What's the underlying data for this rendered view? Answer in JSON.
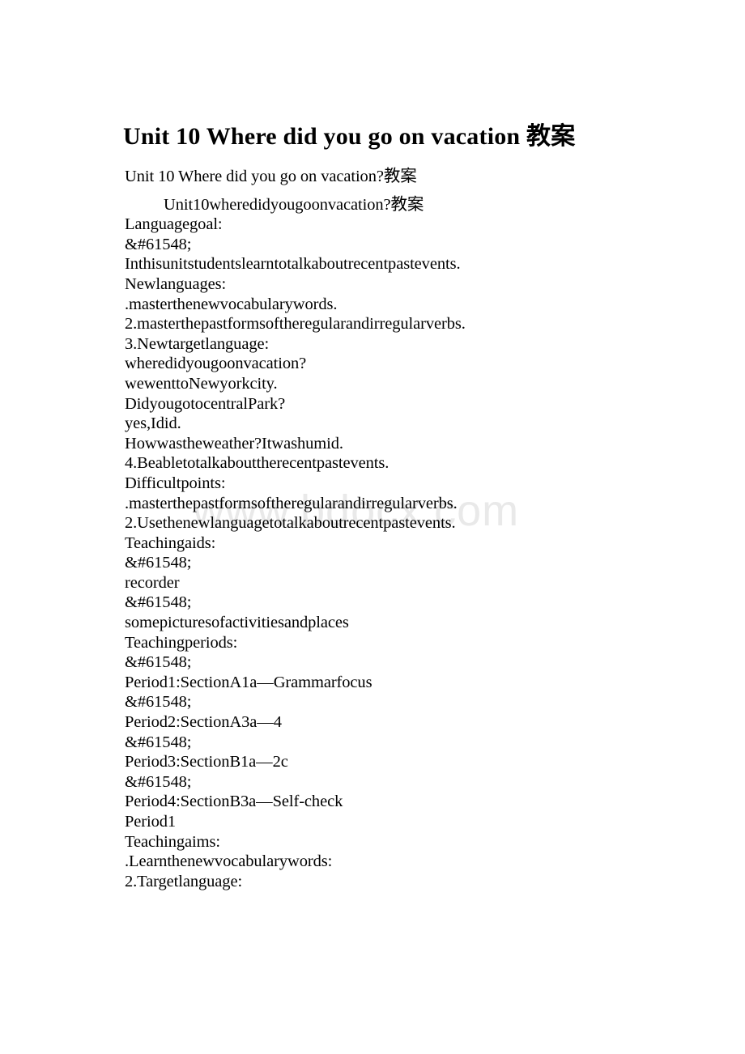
{
  "document": {
    "title": "Unit 10 Where did you go on vacation 教案",
    "watermark": "www.bdocx.com",
    "lines": [
      {
        "text": "Unit 10 Where did you go on vacation?教案",
        "indent": false,
        "gap_before": false
      },
      {
        "text": "Unit10wheredidyougoonvacation?教案",
        "indent": true,
        "gap_before": true
      },
      {
        "text": "Languagegoal:",
        "indent": false,
        "gap_before": false
      },
      {
        "text": "&#61548;",
        "indent": false,
        "gap_before": false
      },
      {
        "text": "Inthisunitstudentslearntotalkaboutrecentpastevents.",
        "indent": false,
        "gap_before": false
      },
      {
        "text": "Newlanguages:",
        "indent": false,
        "gap_before": false
      },
      {
        "text": ".masterthenewvocabularywords.",
        "indent": false,
        "gap_before": false
      },
      {
        "text": "2.masterthepastformsoftheregularandirregularverbs.",
        "indent": false,
        "gap_before": false
      },
      {
        "text": "3.Newtargetlanguage:",
        "indent": false,
        "gap_before": false
      },
      {
        "text": "wheredidyougoonvacation?",
        "indent": false,
        "gap_before": false
      },
      {
        "text": "wewenttoNewyorkcity.",
        "indent": false,
        "gap_before": false
      },
      {
        "text": "DidyougotocentralPark?",
        "indent": false,
        "gap_before": false
      },
      {
        "text": "yes,Idid.",
        "indent": false,
        "gap_before": false
      },
      {
        "text": "Howwastheweather?Itwashumid.",
        "indent": false,
        "gap_before": false
      },
      {
        "text": "4.Beabletotalkabouttherecentpastevents.",
        "indent": false,
        "gap_before": false
      },
      {
        "text": "Difficultpoints:",
        "indent": false,
        "gap_before": false
      },
      {
        "text": ".masterthepastformsoftheregularandirregularverbs.",
        "indent": false,
        "gap_before": false
      },
      {
        "text": "2.Usethenewlanguagetotalkaboutrecentpastevents.",
        "indent": false,
        "gap_before": false
      },
      {
        "text": "Teachingaids:",
        "indent": false,
        "gap_before": false
      },
      {
        "text": "&#61548;",
        "indent": false,
        "gap_before": false
      },
      {
        "text": "recorder",
        "indent": false,
        "gap_before": false
      },
      {
        "text": "&#61548;",
        "indent": false,
        "gap_before": false
      },
      {
        "text": "somepicturesofactivitiesandplaces",
        "indent": false,
        "gap_before": false
      },
      {
        "text": "Teachingperiods:",
        "indent": false,
        "gap_before": false
      },
      {
        "text": "&#61548;",
        "indent": false,
        "gap_before": false
      },
      {
        "text": "Period1:SectionA1a—Grammarfocus",
        "indent": false,
        "gap_before": false
      },
      {
        "text": "&#61548;",
        "indent": false,
        "gap_before": false
      },
      {
        "text": "Period2:SectionA3a—4",
        "indent": false,
        "gap_before": false
      },
      {
        "text": "&#61548;",
        "indent": false,
        "gap_before": false
      },
      {
        "text": "Period3:SectionB1a—2c",
        "indent": false,
        "gap_before": false
      },
      {
        "text": "&#61548;",
        "indent": false,
        "gap_before": false
      },
      {
        "text": "Period4:SectionB3a—Self-check",
        "indent": false,
        "gap_before": false
      },
      {
        "text": "Period1",
        "indent": false,
        "gap_before": false
      },
      {
        "text": "Teachingaims:",
        "indent": false,
        "gap_before": false
      },
      {
        "text": ".Learnthenewvocabularywords:",
        "indent": false,
        "gap_before": false
      },
      {
        "text": "2.Targetlanguage:",
        "indent": false,
        "gap_before": false
      }
    ]
  },
  "colors": {
    "page_background": "#ffffff",
    "text": "#000000",
    "watermark": "#e9e9e9"
  }
}
